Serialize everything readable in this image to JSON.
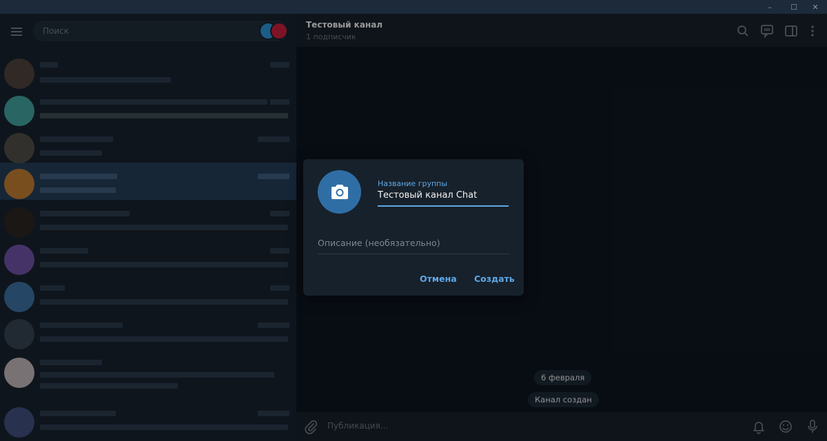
{
  "window": {
    "minimize_label": "–",
    "maximize_label": "☐",
    "close_label": "✕"
  },
  "sidebar": {
    "search_placeholder": "Поиск"
  },
  "chat": {
    "title": "Тестовый канал",
    "subtitle": "1 подписчик",
    "date_pill": "6 февраля",
    "service_message": "Канал создан",
    "composer_placeholder": "Публикация..."
  },
  "dialog": {
    "name_label": "Название группы",
    "name_value": "Тестовый канал Chat",
    "description_placeholder": "Описание (необязательно)",
    "cancel_label": "Отмена",
    "create_label": "Создать"
  },
  "colors": {
    "accent": "#5fa8e6",
    "photo_button": "#2f6ea5",
    "background": "#0e1621",
    "panel": "#17212b"
  },
  "icons": [
    "menu-icon",
    "search-icon",
    "comments-icon",
    "sidebar-toggle-icon",
    "more-icon",
    "camera-icon",
    "paperclip-icon",
    "bell-icon",
    "emoji-icon",
    "microphone-icon"
  ]
}
